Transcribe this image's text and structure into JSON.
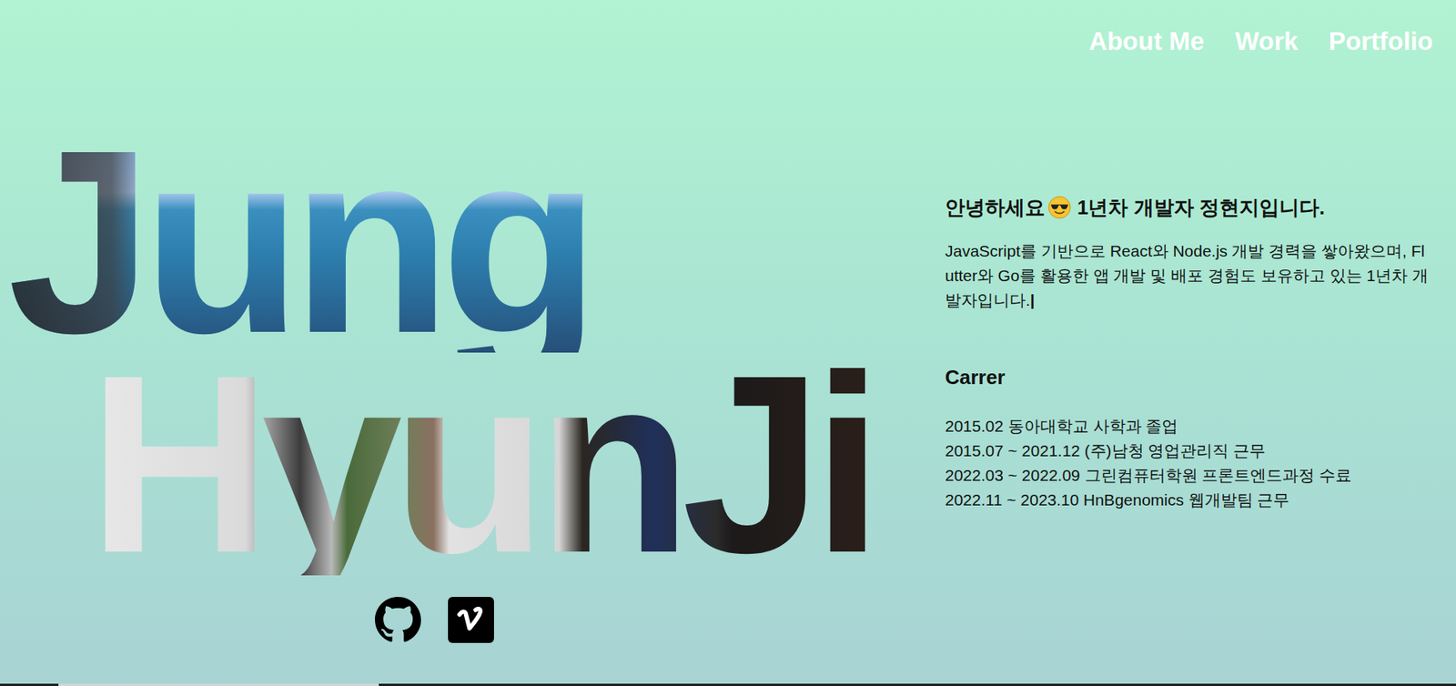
{
  "nav": {
    "items": [
      {
        "label": "About Me"
      },
      {
        "label": "Work"
      },
      {
        "label": "Portfolio"
      }
    ]
  },
  "hero": {
    "name_lines": [
      "Jung",
      "HyunJi"
    ]
  },
  "social": [
    {
      "kind": "github"
    },
    {
      "kind": "vimeo"
    }
  ],
  "intro": {
    "greeting_before": "안녕하세요",
    "greeting_after": "1년차 개발자 정현지입니다.",
    "body": "JavaScript를 기반으로 React와 Node.js 개발 경력을 쌓아왔으며, Flutter와 Go를 활용한 앱 개발 및 배포 경험도 보유하고 있는 1년차 개발자입니다.",
    "cursor": "|"
  },
  "career": {
    "title": "Carrer",
    "items": [
      "2015.02 동아대학교 사학과 졸업",
      "2015.07 ~ 2021.12 (주)남청 영업관리직 근무",
      "2022.03 ~ 2022.09 그린컴퓨터학원 프론트엔드과정 수료",
      "2022.11 ~ 2023.10 HnBgenomics 웹개발팀 근무"
    ]
  }
}
